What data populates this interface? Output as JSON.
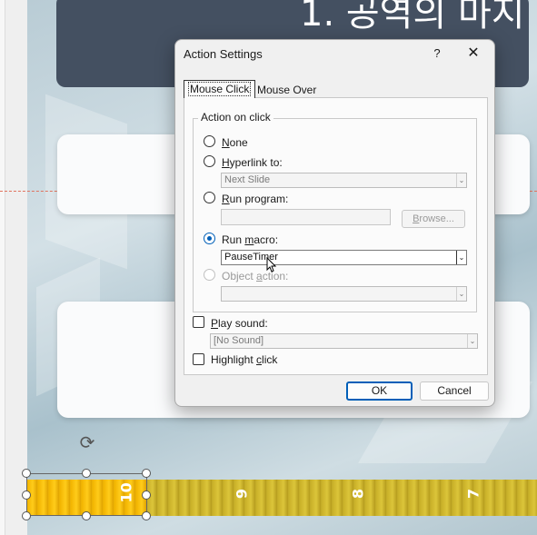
{
  "slide": {
    "title_fragment": "1. 공역의 마지"
  },
  "timer": {
    "labels": [
      "10",
      "9",
      "8",
      "7"
    ]
  },
  "dialog": {
    "title": "Action Settings",
    "help_glyph": "?",
    "close_glyph": "✕",
    "tabs": [
      {
        "label": "Mouse Click",
        "selected": true
      },
      {
        "label": "Mouse Over",
        "selected": false
      }
    ],
    "group_label": "Action on click",
    "options": {
      "none": {
        "pre": "",
        "u": "N",
        "post": "one",
        "checked": false
      },
      "hyperlink": {
        "pre": "",
        "u": "H",
        "post": "yperlink to:",
        "checked": false
      },
      "run_program": {
        "pre": "",
        "u": "R",
        "post": "un program:",
        "checked": false
      },
      "run_macro": {
        "pre": "Run ",
        "u": "m",
        "post": "acro:",
        "checked": true
      },
      "object_action": {
        "pre": "Object ",
        "u": "a",
        "post": "ction:",
        "checked": false,
        "disabled": true
      }
    },
    "hyperlink_value": "Next Slide",
    "program_value": "",
    "browse_label": "Browse...",
    "macro_value": "PauseTimer",
    "object_action_value": "",
    "play_sound": {
      "pre": "",
      "u": "P",
      "post": "lay sound:",
      "checked": false
    },
    "sound_value": "[No Sound]",
    "highlight": {
      "pre": "Highlight ",
      "u": "c",
      "post": "lick",
      "checked": false
    },
    "ok_label": "OK",
    "cancel_label": "Cancel",
    "dropdown_arrow": "⌄",
    "accent_color": "#005fb8"
  }
}
